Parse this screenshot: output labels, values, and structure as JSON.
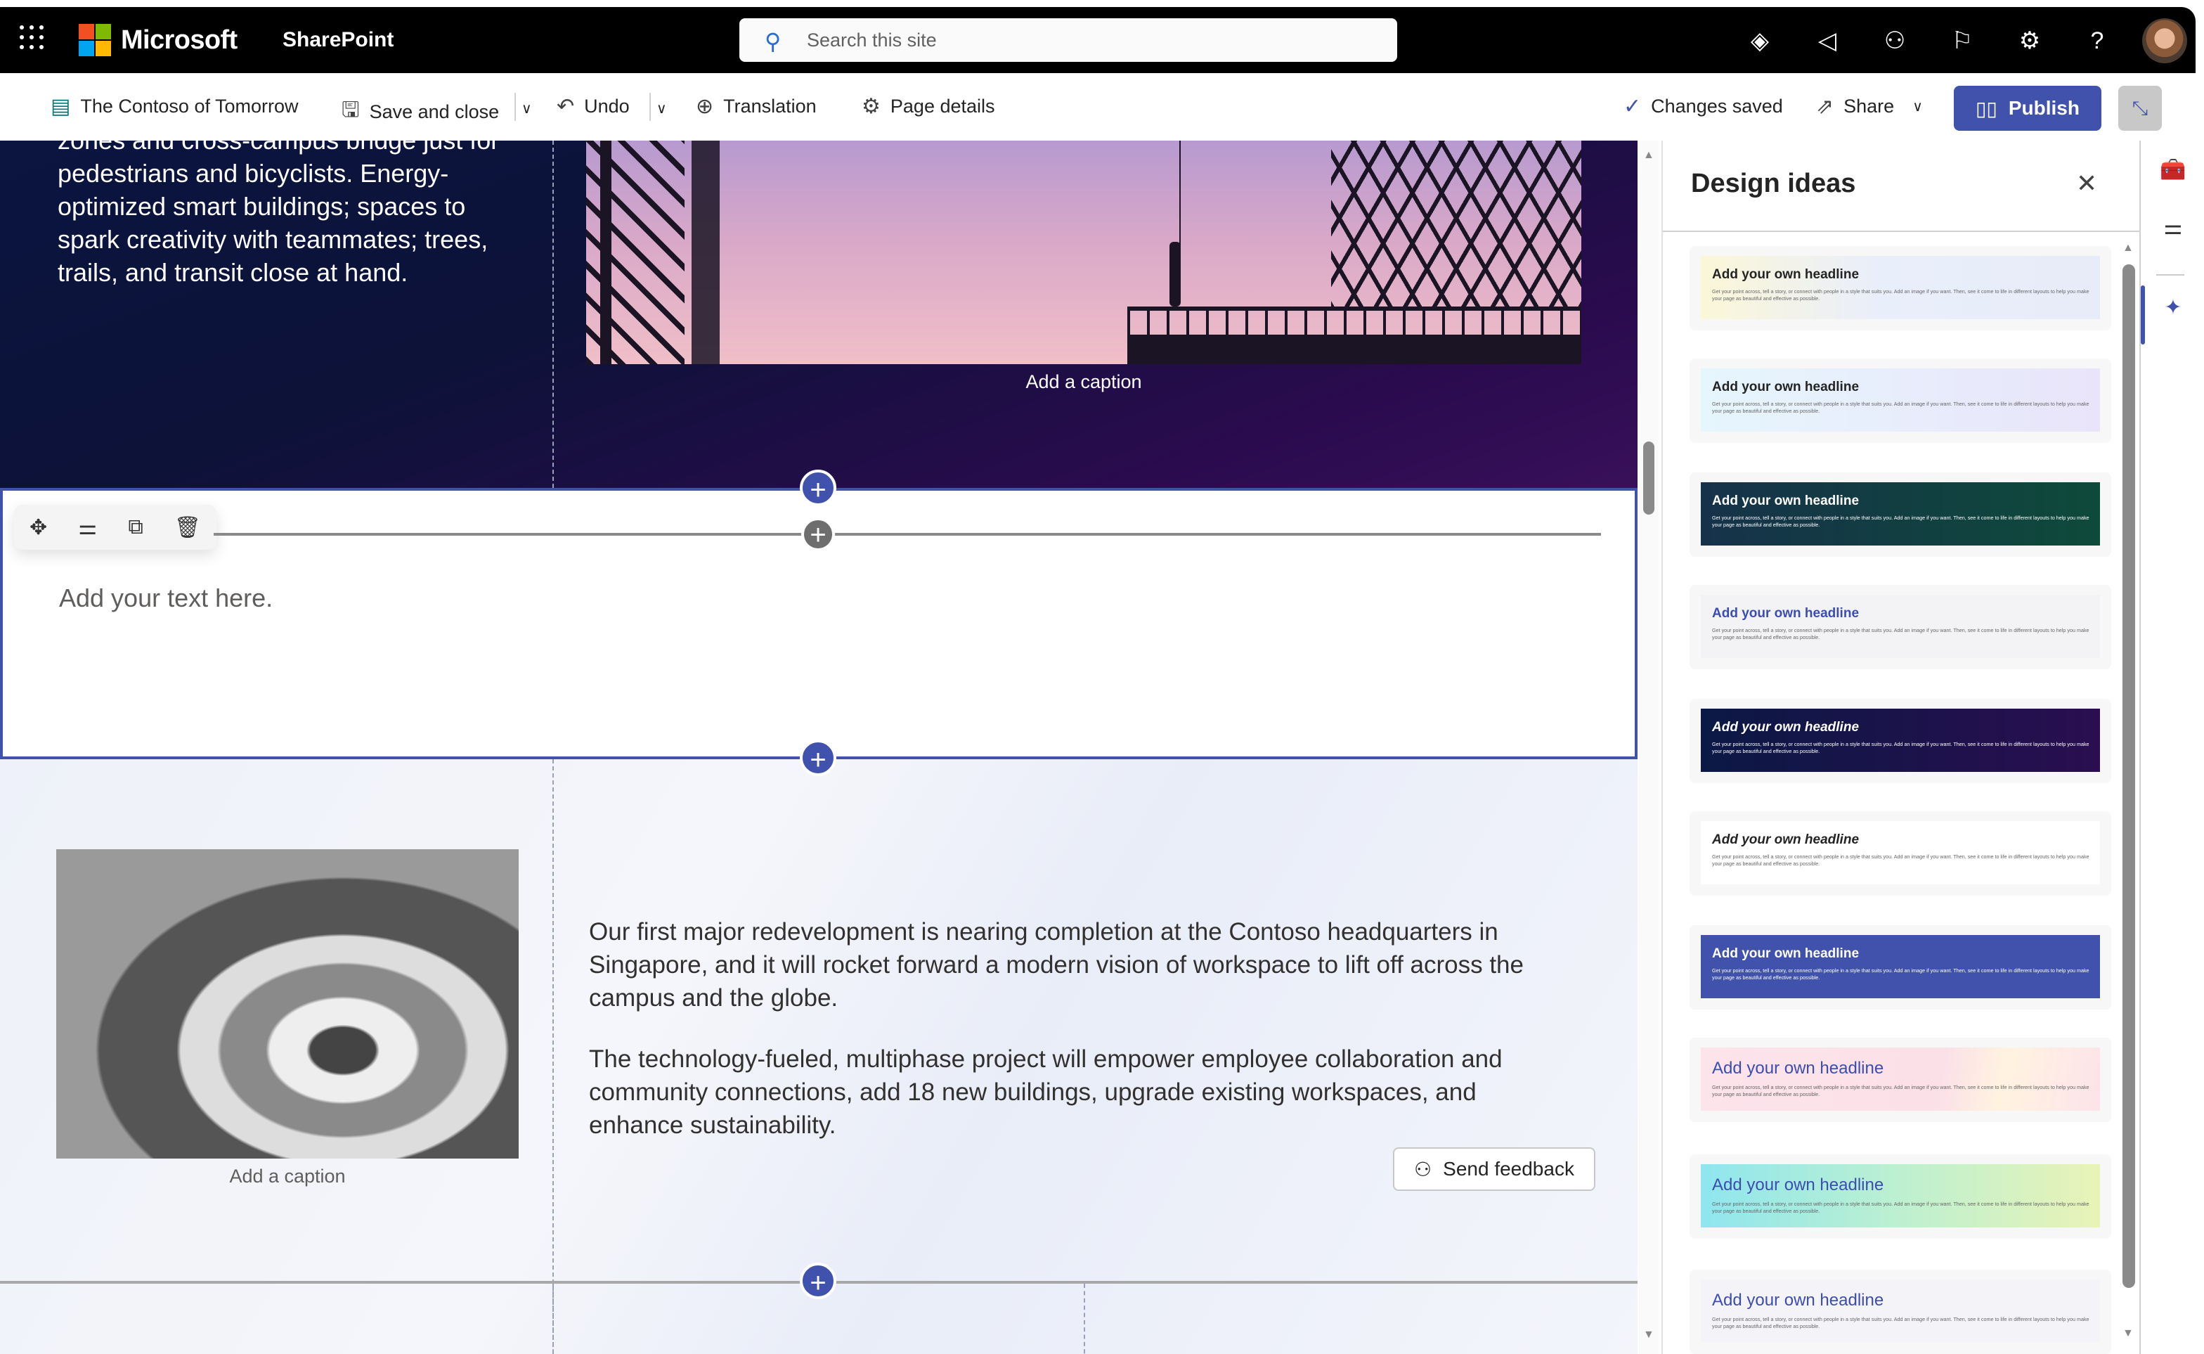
{
  "suite_bar": {
    "brand": "Microsoft",
    "app": "SharePoint",
    "search_placeholder": "Search this site",
    "icons": [
      "copilot-icon",
      "megaphone-icon",
      "people-chat-icon",
      "flag-icon",
      "gear-icon",
      "help-icon"
    ]
  },
  "command_bar": {
    "page_name": "The Contoso of Tomorrow",
    "save_close": "Save and close",
    "undo": "Undo",
    "translation": "Translation",
    "page_details": "Page details",
    "status": "Changes saved",
    "share": "Share",
    "publish": "Publish"
  },
  "canvas": {
    "section1_text": "zones and cross-campus bridge just for pedestrians and bicyclists. Energy-optimized smart buildings; spaces to spark creativity with teammates; trees, trails, and transit close at hand.",
    "caption1": "Add a caption",
    "text_placeholder": "Add your text here.",
    "caption2": "Add a caption",
    "paragraph1": "Our first major redevelopment is nearing completion at the Contoso headquarters in Singapore, and it will rocket forward a modern vision of workspace to lift off across the campus and the globe.",
    "paragraph2": "The technology-fueled, multiphase project will empower employee collaboration and community connections, add 18 new buildings, upgrade existing workspaces, and enhance sustainability.",
    "send_feedback": "Send feedback"
  },
  "design_ideas": {
    "title": "Design ideas",
    "headline": "Add your own headline",
    "body": "Get your point across, tell a story, or connect with people in a style that suits you. Add an image if you want. Then, see it come to life in different layouts to help you make your page as beautiful and effective as possible."
  },
  "colors": {
    "accent": "#4052ab",
    "suite_bar": "#000000"
  }
}
